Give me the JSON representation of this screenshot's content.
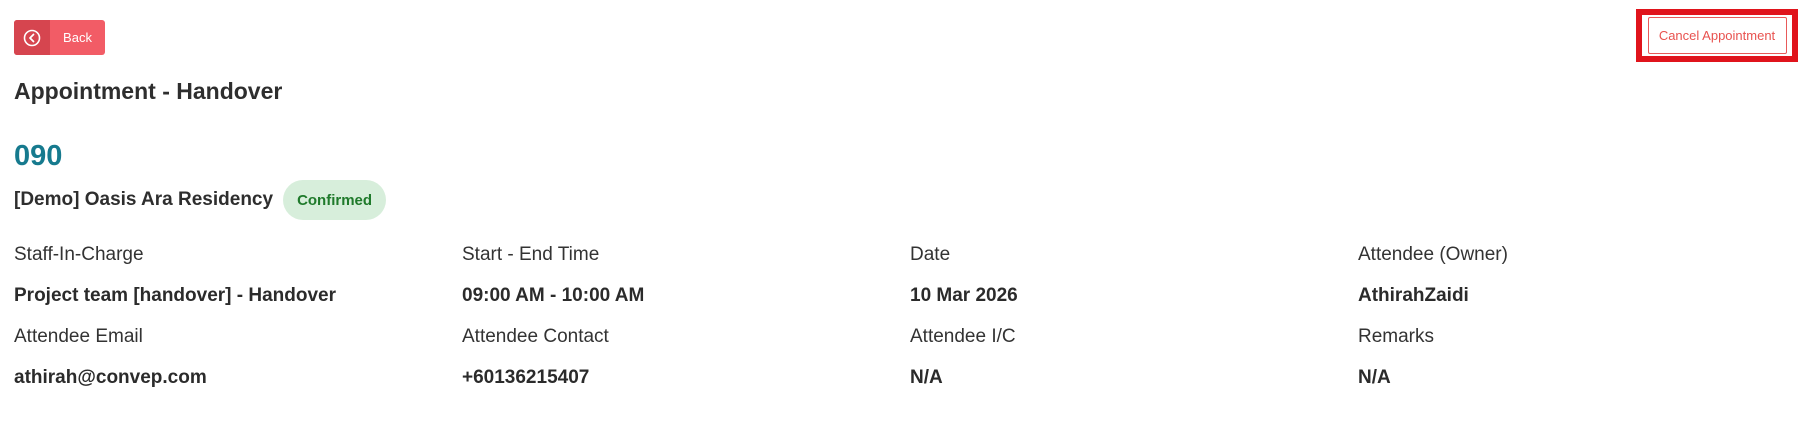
{
  "header": {
    "back_label": "Back",
    "cancel_label": "Cancel Appointment",
    "title": "Appointment - Handover"
  },
  "appointment": {
    "unit_number": "090",
    "project_name": "[Demo] Oasis Ara Residency",
    "status": "Confirmed"
  },
  "details": [
    {
      "label": "Staff-In-Charge",
      "value": "Project team [handover] - Handover"
    },
    {
      "label": "Start - End Time",
      "value": "09:00 AM - 10:00 AM"
    },
    {
      "label": "Date",
      "value": "10 Mar 2026"
    },
    {
      "label": "Attendee (Owner)",
      "value": "AthirahZaidi"
    },
    {
      "label": "Attendee Email",
      "value": "athirah@convep.com"
    },
    {
      "label": "Attendee Contact",
      "value": "+60136215407"
    },
    {
      "label": "Attendee I/C",
      "value": "N/A"
    },
    {
      "label": "Remarks",
      "value": "N/A"
    }
  ],
  "colors": {
    "accent_teal": "#167a8e",
    "back_button": "#f25c66",
    "cancel_text": "#e8524f",
    "highlight_border": "#e0141c",
    "status_bg": "#d7eedb",
    "status_text": "#1f7a2b"
  },
  "icons": {
    "back": "chevron-left-circle-icon"
  }
}
